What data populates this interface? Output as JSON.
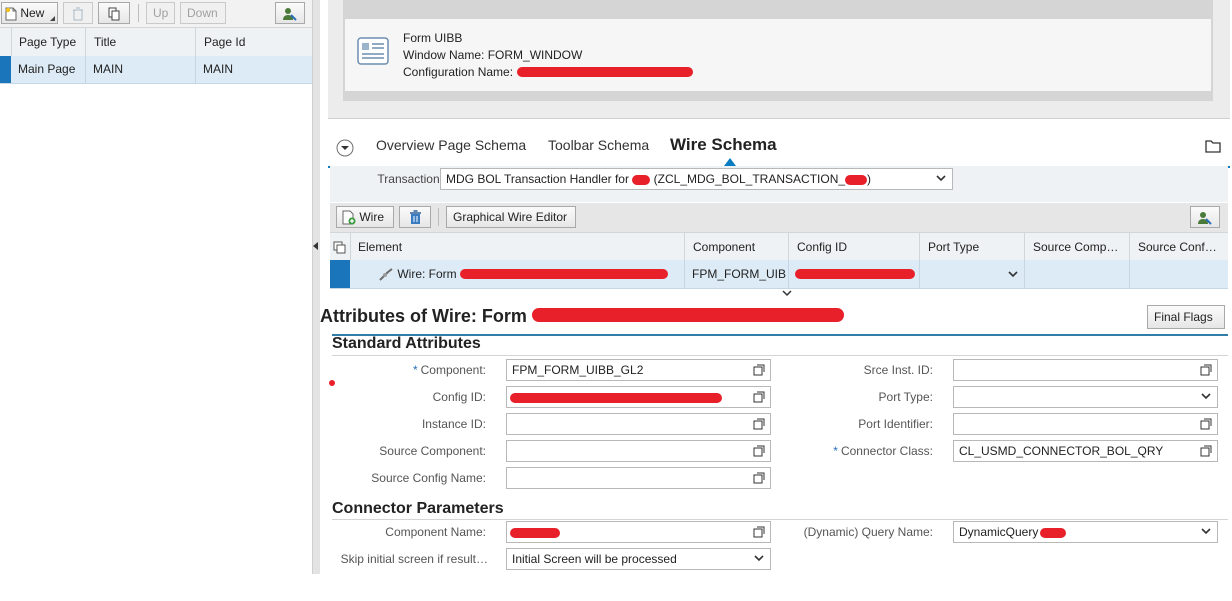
{
  "left_toolbar": {
    "new_label": "New",
    "up_label": "Up",
    "down_label": "Down"
  },
  "pages_table": {
    "headers": [
      "Page Type",
      "Title",
      "Page Id"
    ],
    "rows": [
      {
        "page_type": "Main Page",
        "title": "MAIN",
        "page_id": "MAIN"
      }
    ]
  },
  "uibb_card": {
    "type": "Form UIBB",
    "window_name": "Window Name: FORM_WINDOW",
    "config_name": "Configuration Name:"
  },
  "schema_tabs": {
    "overview": "Overview Page Schema",
    "toolbar": "Toolbar Schema",
    "wire": "Wire Schema",
    "active": "wire"
  },
  "transaction": {
    "label": "Transaction:",
    "value_prefix": "MDG BOL Transaction Handler for",
    "value_class": "(ZCL_MDG_BOL_TRANSACTION_",
    "value_close": ")"
  },
  "wire_toolbar": {
    "wire_label": "Wire",
    "graphical_editor_label": "Graphical Wire Editor"
  },
  "wire_table": {
    "headers": [
      "Element",
      "Component",
      "Config ID",
      "Port Type",
      "Source Comp…",
      "Source Conf…"
    ],
    "rows": [
      {
        "element": "Wire: Form",
        "component": "FPM_FORM_UIB",
        "config_id": "",
        "port_type": "",
        "source_comp": "",
        "source_conf": ""
      }
    ]
  },
  "attributes": {
    "title": "Attributes of Wire: Form",
    "final_flags_label": "Final Flags",
    "standard_section": "Standard Attributes",
    "fields": {
      "component_label": "Component:",
      "component_value": "FPM_FORM_UIBB_GL2",
      "config_id_label": "Config ID:",
      "instance_id_label": "Instance ID:",
      "source_component_label": "Source Component:",
      "source_config_name_label": "Source Config Name:",
      "srce_inst_id_label": "Srce Inst. ID:",
      "port_type_label": "Port Type:",
      "port_identifier_label": "Port Identifier:",
      "connector_class_label": "Connector Class:",
      "connector_class_value": "CL_USMD_CONNECTOR_BOL_QRY"
    },
    "connector_section": "Connector Parameters",
    "connector": {
      "component_name_label": "Component Name:",
      "skip_label": "Skip initial screen if result…",
      "skip_value": "Initial Screen will be processed",
      "query_name_label": "(Dynamic) Query Name:",
      "query_name_value": "DynamicQuery"
    }
  },
  "colors": {
    "selection_row": "#dcebf5",
    "selection_marker": "#1b75bb",
    "active_tab_indicator": "#0a7cc1",
    "section_rule": "#2f7fa8",
    "redaction": "#e8202a"
  }
}
